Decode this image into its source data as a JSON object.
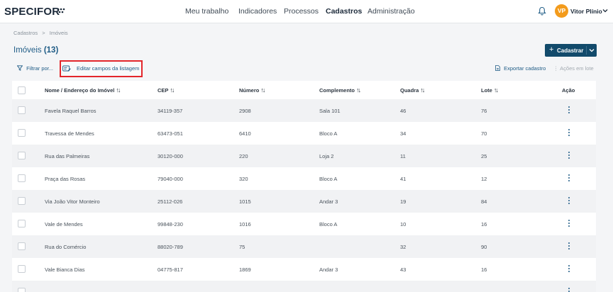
{
  "app": {
    "logo": "SPECIFOR",
    "nav": [
      {
        "label": "Meu trabalho",
        "active": false
      },
      {
        "label": "Indicadores",
        "active": false
      },
      {
        "label": "Processos",
        "active": false
      },
      {
        "label": "Cadastros",
        "active": true
      },
      {
        "label": "Administração",
        "active": false
      }
    ],
    "user": {
      "initials": "VP",
      "name": "Vitor Plínio"
    }
  },
  "breadcrumb": {
    "root": "Cadastros",
    "separator": ">",
    "current": "Imóveis"
  },
  "page": {
    "title": "Imóveis",
    "count": "(13)"
  },
  "toolbar": {
    "cadastrar": "Cadastrar",
    "filter": "Filtrar por...",
    "edit_fields": "Editar campos da listagem",
    "export": "Exportar cadastro",
    "batch": "⋮ Ações em lote"
  },
  "table": {
    "headers": {
      "name": "Nome / Endereço do Imóvel",
      "cep": "CEP",
      "numero": "Número",
      "complemento": "Complemento",
      "quadra": "Quadra",
      "lote": "Lote",
      "acao": "Ação"
    },
    "rows": [
      {
        "name": "Favela Raquel Barros",
        "cep": "34119-357",
        "numero": "2908",
        "complemento": "Sala 101",
        "quadra": "46",
        "lote": "76"
      },
      {
        "name": "Travessa de Mendes",
        "cep": "63473-051",
        "numero": "6410",
        "complemento": "Bloco A",
        "quadra": "34",
        "lote": "70"
      },
      {
        "name": "Rua das Palmeiras",
        "cep": "30120-000",
        "numero": "220",
        "complemento": "Loja 2",
        "quadra": "11",
        "lote": "25"
      },
      {
        "name": "Praça das Rosas",
        "cep": "79040-000",
        "numero": "320",
        "complemento": "Bloco A",
        "quadra": "41",
        "lote": "12"
      },
      {
        "name": "Via João Vitor Monteiro",
        "cep": "25112-026",
        "numero": "1015",
        "complemento": "Andar 3",
        "quadra": "19",
        "lote": "84"
      },
      {
        "name": "Vale de Mendes",
        "cep": "99848-230",
        "numero": "1016",
        "complemento": "Bloco A",
        "quadra": "10",
        "lote": "16"
      },
      {
        "name": "Rua do Comércio",
        "cep": "88020-789",
        "numero": "75",
        "complemento": "",
        "quadra": "32",
        "lote": "90"
      },
      {
        "name": "Vale Bianca Dias",
        "cep": "04775-817",
        "numero": "1869",
        "complemento": "Andar 3",
        "quadra": "43",
        "lote": "16"
      }
    ]
  },
  "colors": {
    "brand": "#124a6b",
    "link": "#1f5c86",
    "avatar": "#f39b1c",
    "highlight": "#e3262b"
  },
  "icons": [
    "bell-icon",
    "chevron-down-icon",
    "filter-icon",
    "edit-list-icon",
    "export-icon",
    "kebab-icon"
  ]
}
